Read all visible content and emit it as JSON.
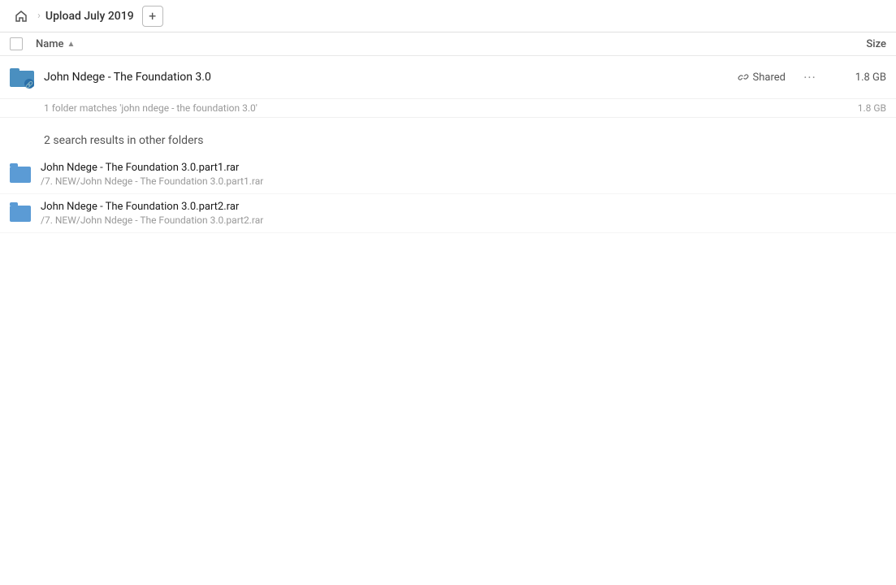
{
  "topbar": {
    "home_icon": "home",
    "breadcrumb_sep": "›",
    "title": "Upload July 2019",
    "add_btn": "+"
  },
  "columns": {
    "checkbox": "",
    "name_label": "Name",
    "sort_arrow": "▲",
    "size_label": "Size"
  },
  "main_result": {
    "name": "John Ndege - The Foundation 3.0",
    "shared_label": "Shared",
    "more_icon": "•••",
    "size": "1.8 GB"
  },
  "folder_match": {
    "text": "1 folder matches 'john ndege - the foundation 3.0'",
    "size": "1.8 GB"
  },
  "other_results_header": "2 search results in other folders",
  "other_results": [
    {
      "name": "John Ndege - The Foundation 3.0.part1.rar",
      "path": "/7. NEW/John Ndege - The Foundation 3.0.part1.rar"
    },
    {
      "name": "John Ndege - The Foundation 3.0.part2.rar",
      "path": "/7. NEW/John Ndege - The Foundation 3.0.part2.rar"
    }
  ],
  "icons": {
    "home": "⌂",
    "link": "🔗",
    "more": "···"
  },
  "colors": {
    "folder_blue": "#4a8fc0",
    "link_color": "#6b9fd4",
    "shared_color": "#666"
  }
}
